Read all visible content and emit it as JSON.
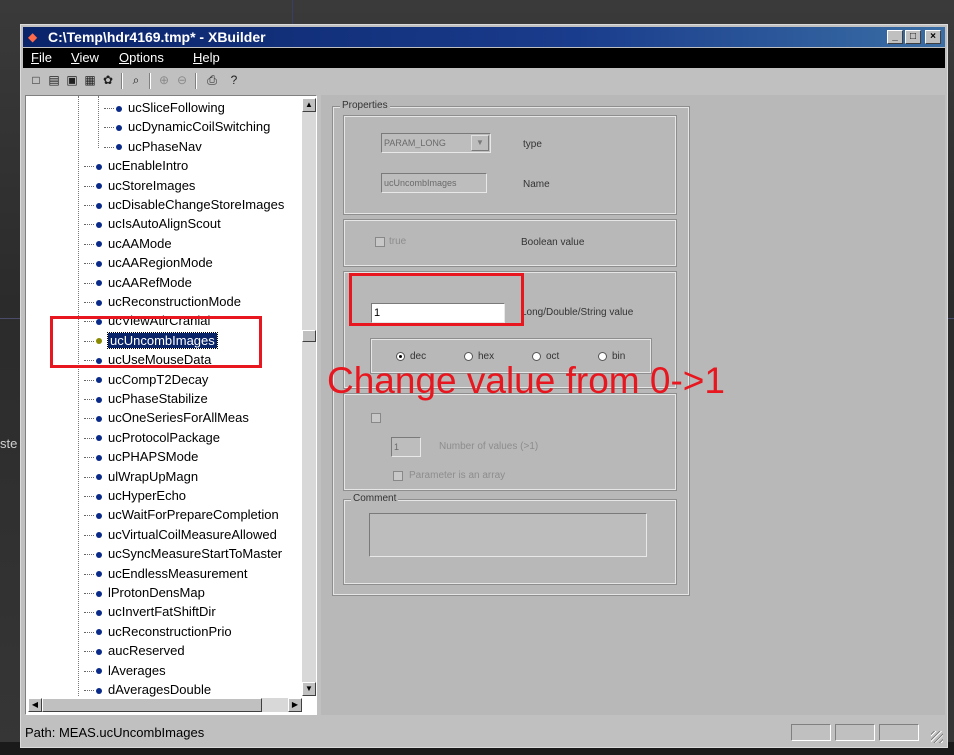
{
  "window": {
    "title": "C:\\Temp\\hdr4169.tmp* - XBuilder",
    "controls": {
      "minimize": "_",
      "maximize": "□",
      "close": "×"
    }
  },
  "menu": {
    "file": {
      "mnemonic": "F",
      "rest": "ile"
    },
    "view": {
      "mnemonic": "V",
      "rest": "iew"
    },
    "options": {
      "mnemonic": "O",
      "rest": "ptions"
    },
    "help": {
      "mnemonic": "H",
      "rest": "elp"
    }
  },
  "toolbar": {
    "icons": [
      "new-icon",
      "open-icon",
      "save-icon",
      "save-as-icon",
      "tool-icon",
      "find-icon",
      "zoom-in-icon",
      "zoom-out-icon",
      "print-icon",
      "help-icon"
    ]
  },
  "tree": {
    "items": [
      "ucSliceFollowing",
      "ucDynamicCoilSwitching",
      "ucPhaseNav",
      "ucEnableIntro",
      "ucStoreImages",
      "ucDisableChangeStoreImages",
      "ucIsAutoAlignScout",
      "ucAAMode",
      "ucAARegionMode",
      "ucAARefMode",
      "ucReconstructionMode",
      "ucViewAtlrCranial",
      "ucUncombImages",
      "ucUseMouseData",
      "ucCompT2Decay",
      "ucPhaseStabilize",
      "ucOneSeriesForAllMeas",
      "ucProtocolPackage",
      "ucPHAPSMode",
      "ulWrapUpMagn",
      "ucHyperEcho",
      "ucWaitForPrepareCompletion",
      "ucVirtualCoilMeasureAllowed",
      "ucSyncMeasureStartToMaster",
      "ucEndlessMeasurement",
      "lProtonDensMap",
      "ucInvertFatShiftDir",
      "ucReconstructionPrio",
      "aucReserved",
      "lAverages",
      "dAveragesDouble"
    ],
    "selected_index": 12
  },
  "properties": {
    "group_title": "Properties",
    "type_value": "PARAM_LONG",
    "type_label": "type",
    "name_value": "ucUncombImages",
    "name_label": "Name",
    "bool_checkbox_label": "true",
    "bool_label": "Boolean value",
    "value_input": "1",
    "value_label": "Long/Double/String value",
    "radios": [
      "dec",
      "hex",
      "oct",
      "bin"
    ],
    "selected_radio": "dec",
    "array_count_value": "1",
    "array_count_label": "Number of values (>1)",
    "array_checkbox_label": "Parameter is an array"
  },
  "comment": {
    "group_title": "Comment",
    "value": ""
  },
  "annotation": {
    "text": "Change value from 0->1"
  },
  "status": {
    "path": "Path: MEAS.ucUncombImages"
  },
  "desktop": {
    "side_text": "ste"
  }
}
